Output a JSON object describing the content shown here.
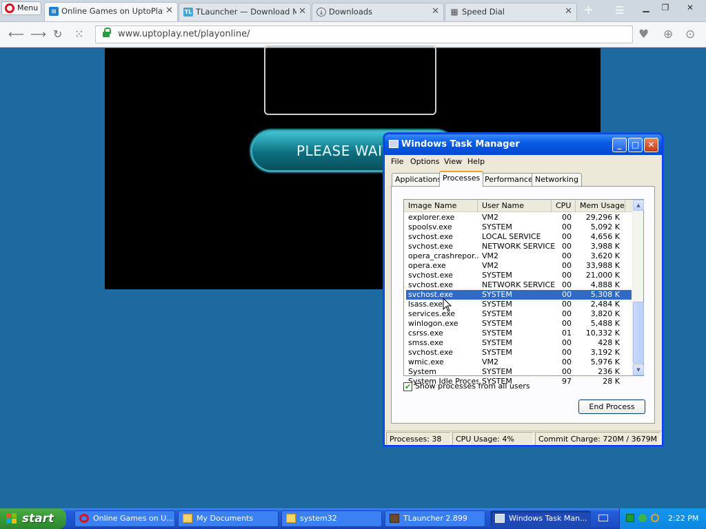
{
  "browser": {
    "menu_label": "Menu",
    "tabs": [
      {
        "title": "Online Games on UptoPlay —",
        "icon": "uptoplay-icon",
        "active": true
      },
      {
        "title": "TLauncher — Download Mine",
        "icon": "tlauncher-icon",
        "active": false
      },
      {
        "title": "Downloads",
        "icon": "download-icon",
        "active": false
      },
      {
        "title": "Speed Dial",
        "icon": "speed-dial-icon",
        "active": false
      }
    ],
    "url": "www.uptoplay.net/playonline/",
    "accent": "#d8121f"
  },
  "page": {
    "wait_button": "PLEASE WAIT"
  },
  "task_manager": {
    "title": "Windows Task Manager",
    "menu": [
      "File",
      "Options",
      "View",
      "Help"
    ],
    "tabs": [
      "Applications",
      "Processes",
      "Performance",
      "Networking"
    ],
    "active_tab": "Processes",
    "columns": [
      "Image Name",
      "User Name",
      "CPU",
      "Mem Usage"
    ],
    "processes": [
      {
        "name": "explorer.exe",
        "user": "VM2",
        "cpu": "00",
        "mem": "29,296 K"
      },
      {
        "name": "spoolsv.exe",
        "user": "SYSTEM",
        "cpu": "00",
        "mem": "5,092 K"
      },
      {
        "name": "svchost.exe",
        "user": "LOCAL SERVICE",
        "cpu": "00",
        "mem": "4,656 K"
      },
      {
        "name": "svchost.exe",
        "user": "NETWORK SERVICE",
        "cpu": "00",
        "mem": "3,988 K"
      },
      {
        "name": "opera_crashrepor...",
        "user": "VM2",
        "cpu": "00",
        "mem": "3,620 K"
      },
      {
        "name": "opera.exe",
        "user": "VM2",
        "cpu": "00",
        "mem": "33,988 K"
      },
      {
        "name": "svchost.exe",
        "user": "SYSTEM",
        "cpu": "00",
        "mem": "21,000 K"
      },
      {
        "name": "svchost.exe",
        "user": "NETWORK SERVICE",
        "cpu": "00",
        "mem": "4,888 K"
      },
      {
        "name": "svchost.exe",
        "user": "SYSTEM",
        "cpu": "00",
        "mem": "5,308 K",
        "selected": true
      },
      {
        "name": "lsass.exe",
        "user": "SYSTEM",
        "cpu": "00",
        "mem": "2,484 K"
      },
      {
        "name": "services.exe",
        "user": "SYSTEM",
        "cpu": "00",
        "mem": "3,820 K"
      },
      {
        "name": "winlogon.exe",
        "user": "SYSTEM",
        "cpu": "00",
        "mem": "5,488 K"
      },
      {
        "name": "csrss.exe",
        "user": "SYSTEM",
        "cpu": "01",
        "mem": "10,332 K"
      },
      {
        "name": "smss.exe",
        "user": "SYSTEM",
        "cpu": "00",
        "mem": "428 K"
      },
      {
        "name": "svchost.exe",
        "user": "SYSTEM",
        "cpu": "00",
        "mem": "3,192 K"
      },
      {
        "name": "wmic.exe",
        "user": "VM2",
        "cpu": "00",
        "mem": "5,976 K"
      },
      {
        "name": "System",
        "user": "SYSTEM",
        "cpu": "00",
        "mem": "236 K"
      },
      {
        "name": "System Idle Process",
        "user": "SYSTEM",
        "cpu": "97",
        "mem": "28 K"
      }
    ],
    "show_all_label": "Show processes from all users",
    "show_all_checked": true,
    "end_process_label": "End Process",
    "status": {
      "processes": "Processes: 38",
      "cpu": "CPU Usage: 4%",
      "commit": "Commit Charge: 720M / 3679M"
    }
  },
  "taskbar": {
    "start_label": "start",
    "items": [
      {
        "label": "Online Games on U...",
        "icon": "opera-icon",
        "active": false
      },
      {
        "label": "My Documents",
        "icon": "folder-icon",
        "active": false
      },
      {
        "label": "system32",
        "icon": "folder-icon",
        "active": false
      },
      {
        "label": "TLauncher 2.899",
        "icon": "tlauncher-icon",
        "active": false
      },
      {
        "label": "Windows Task Man...",
        "icon": "task-manager-icon",
        "active": true
      }
    ],
    "clock": "2:22 PM"
  }
}
